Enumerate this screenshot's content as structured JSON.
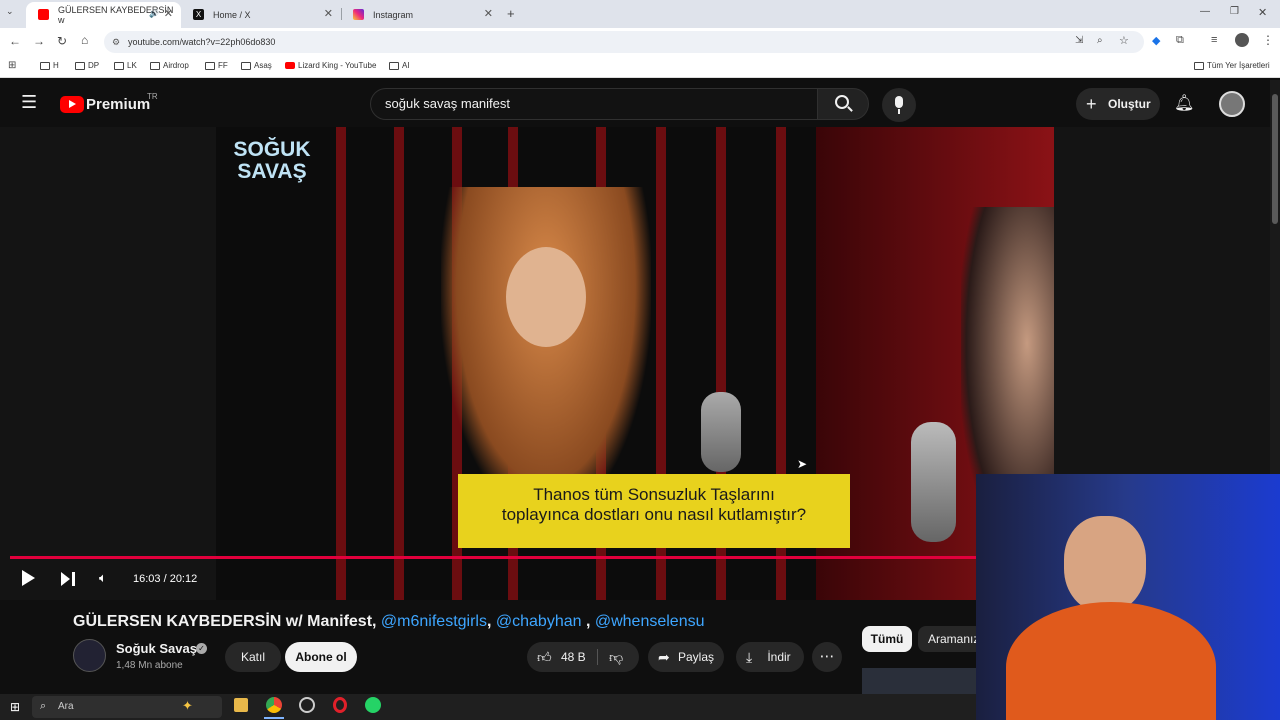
{
  "browser": {
    "tabs": [
      {
        "label": "GÜLERSEN KAYBEDERSİN w",
        "favicon": "youtube-favicon",
        "active": true
      },
      {
        "label": "Home / X",
        "favicon": "x-favicon",
        "active": false
      },
      {
        "label": "Instagram",
        "favicon": "instagram-favicon",
        "active": false
      }
    ],
    "url": "youtube.com/watch?v=22ph06do830",
    "bookmarks": [
      "H",
      "DP",
      "LK",
      "Airdrop",
      "FF",
      "Asaş",
      "Lizard King - YouTube",
      "AI"
    ],
    "all_bookmarks_label": "Tüm Yer İşaretleri"
  },
  "youtube": {
    "logo_text": "Premium",
    "region": "TR",
    "search_value": "soğuk savaş manifest",
    "create_label": "Oluştur"
  },
  "video": {
    "channel_logo_line1": "SOĞUK",
    "channel_logo_line2": "SAVAŞ",
    "caption_line1": "Thanos tüm Sonsuzluk Taşlarını",
    "caption_line2": "toplayınca dostları onu nasıl kutlamıştır?",
    "time": "16:03 / 20:12",
    "progress": 0.796
  },
  "details": {
    "title_main": "GÜLERSEN KAYBEDERSİN w/ Manifest,",
    "mention1": "@m6nifestgirls",
    "comma1": ",",
    "mention2": "@chabyhan",
    "comma2": " ,",
    "mention3": "@whenselensu",
    "channel_name": "Soğuk Savaş",
    "subscribers": "1,48 Mn abone",
    "join_label": "Katıl",
    "subscribe_label": "Abone ol",
    "likes": "48 B",
    "share_label": "Paylaş",
    "download_label": "İndir",
    "chips": [
      "Tümü",
      "Aramanız"
    ]
  },
  "taskbar": {
    "search_placeholder": "Ara"
  },
  "colors": {
    "accent_red": "#ff0000",
    "progress_red": "#e1003c",
    "link_blue": "#3ea6ff",
    "caption_yellow": "#e8d21d"
  }
}
